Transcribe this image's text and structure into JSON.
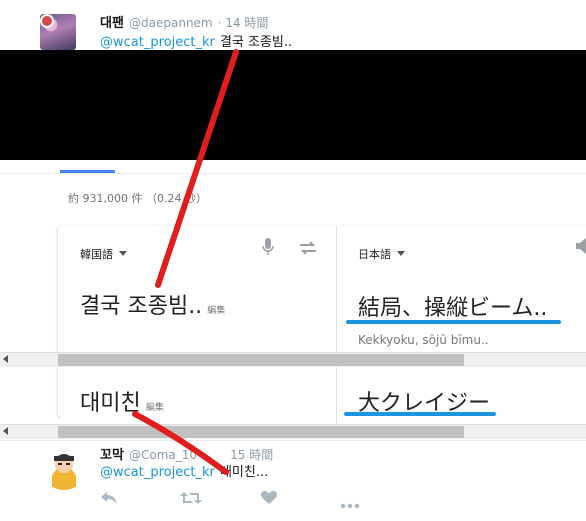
{
  "tweet1": {
    "display_name": "대팬",
    "handle": "@daepannem",
    "time": "· 14 時間",
    "mention": "@wcat_project_kr",
    "text": "결국 조종빔.."
  },
  "search": {
    "tab_accent": "#4285f4",
    "results": "約 931,000 件 （0.24 秒）"
  },
  "translate": {
    "source_lang": "韓国語",
    "target_lang": "日本語",
    "source_text": "결국 조종빔..",
    "edit_label": "編集",
    "target_text": "結局、操縦ビーム..",
    "romanization": "Kekkyoku, sōjū bīmu.."
  },
  "translate2": {
    "source_text": "대미친",
    "edit_label": "編集",
    "target_text": "大クレイジー"
  },
  "tweet2": {
    "display_name": "꼬막",
    "handle": "@Coma_10",
    "time": "15 時間",
    "mention": "@wcat_project_kr",
    "text": "대미친..."
  },
  "icons": {
    "mic": "mic-icon",
    "swap": "swap-icon",
    "speaker": "speaker-icon",
    "reply": "reply-icon",
    "retweet": "retweet-icon",
    "like": "heart-icon",
    "more": "more-icon"
  },
  "colors": {
    "annotation_red": "#e01e1e",
    "annotation_blue": "#1b95e0",
    "link": "#1b95e0"
  }
}
